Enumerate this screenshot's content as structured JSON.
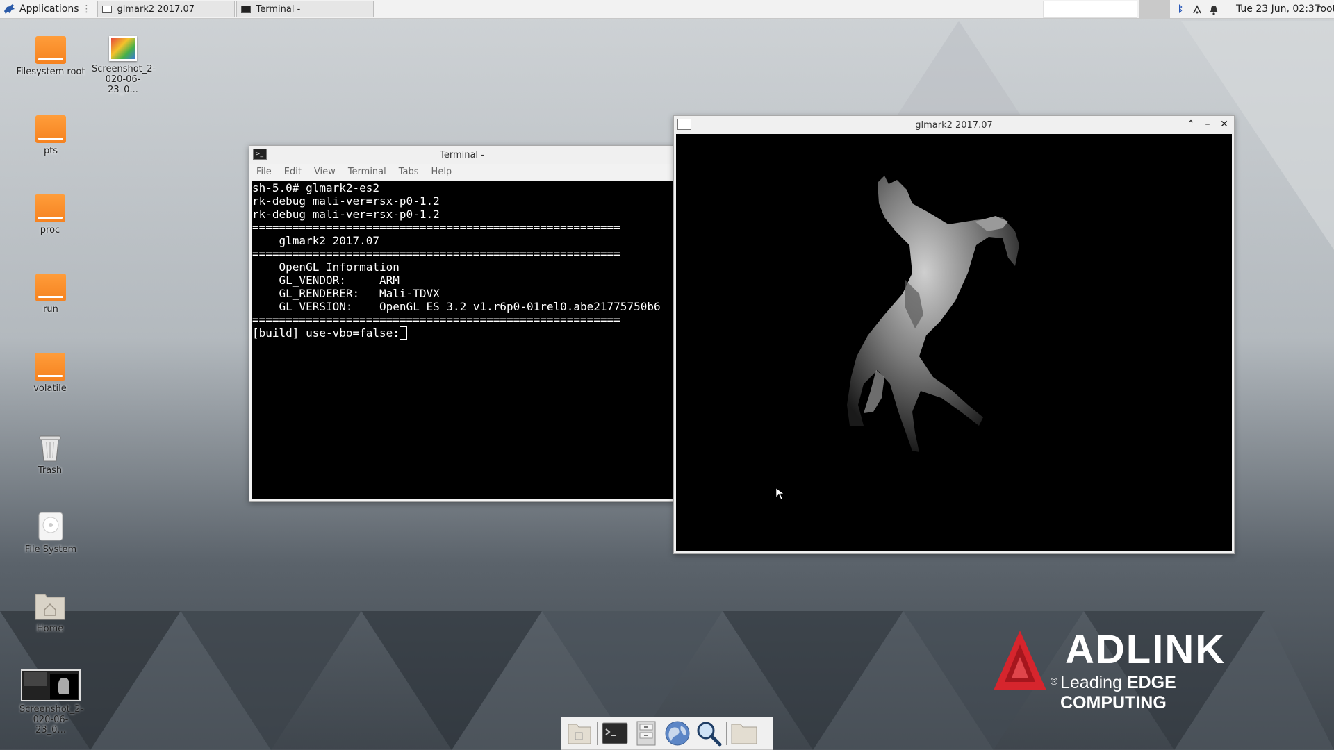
{
  "top_panel": {
    "applications_label": "Applications",
    "tasks": [
      {
        "label": "glmark2 2017.07",
        "icon": "window-icon"
      },
      {
        "label": "Terminal -",
        "icon": "terminal-icon"
      }
    ],
    "clock": "Tue 23 Jun, 02:37",
    "user": "root",
    "tray_icons": [
      "bluetooth-icon",
      "network-icon",
      "notification-bell-icon"
    ]
  },
  "desktop": {
    "icons": [
      {
        "label": "Filesystem root",
        "icon": "drive-icon"
      },
      {
        "label": "Screenshot_2-020-06-23_0...",
        "icon": "image-file-icon"
      },
      {
        "label": "pts",
        "icon": "drive-icon"
      },
      {
        "label": "proc",
        "icon": "drive-icon"
      },
      {
        "label": "run",
        "icon": "drive-icon"
      },
      {
        "label": "volatile",
        "icon": "drive-icon"
      },
      {
        "label": "Trash",
        "icon": "trash-icon"
      },
      {
        "label": "File System",
        "icon": "hard-disk-icon"
      },
      {
        "label": "Home",
        "icon": "home-folder-icon"
      },
      {
        "label": "Screenshot_2-020-06-23_0...",
        "icon": "screenshot-thumbnail-icon"
      }
    ]
  },
  "terminal_window": {
    "title": "Terminal -",
    "menu": [
      "File",
      "Edit",
      "View",
      "Terminal",
      "Tabs",
      "Help"
    ],
    "lines": [
      "sh-5.0# glmark2-es2",
      "rk-debug mali-ver=rsx-p0-1.2",
      "rk-debug mali-ver=rsx-p0-1.2",
      "=======================================================",
      "    glmark2 2017.07",
      "=======================================================",
      "    OpenGL Information",
      "    GL_VENDOR:     ARM",
      "    GL_RENDERER:   Mali-TDVX",
      "    GL_VERSION:    OpenGL ES 3.2 v1.r6p0-01rel0.abe21775750b6",
      "======================================================="
    ],
    "prompt_line": "[build] use-vbo=false:"
  },
  "glmark_window": {
    "title": "glmark2 2017.07",
    "buttons": [
      "maximize-icon",
      "minimize-icon",
      "close-icon"
    ]
  },
  "dock": {
    "items": [
      "show-desktop-icon",
      "terminal-icon",
      "file-manager-icon",
      "web-browser-icon",
      "search-icon",
      "folder-icon"
    ]
  },
  "logo": {
    "brand": "ADLINK",
    "tagline_prefix": "Leading ",
    "tagline_bold": "EDGE COMPUTING",
    "registered": "®"
  },
  "colors": {
    "drive_orange": "#f58220",
    "logo_red": "#d6252d",
    "terminal_bg": "#000000"
  }
}
